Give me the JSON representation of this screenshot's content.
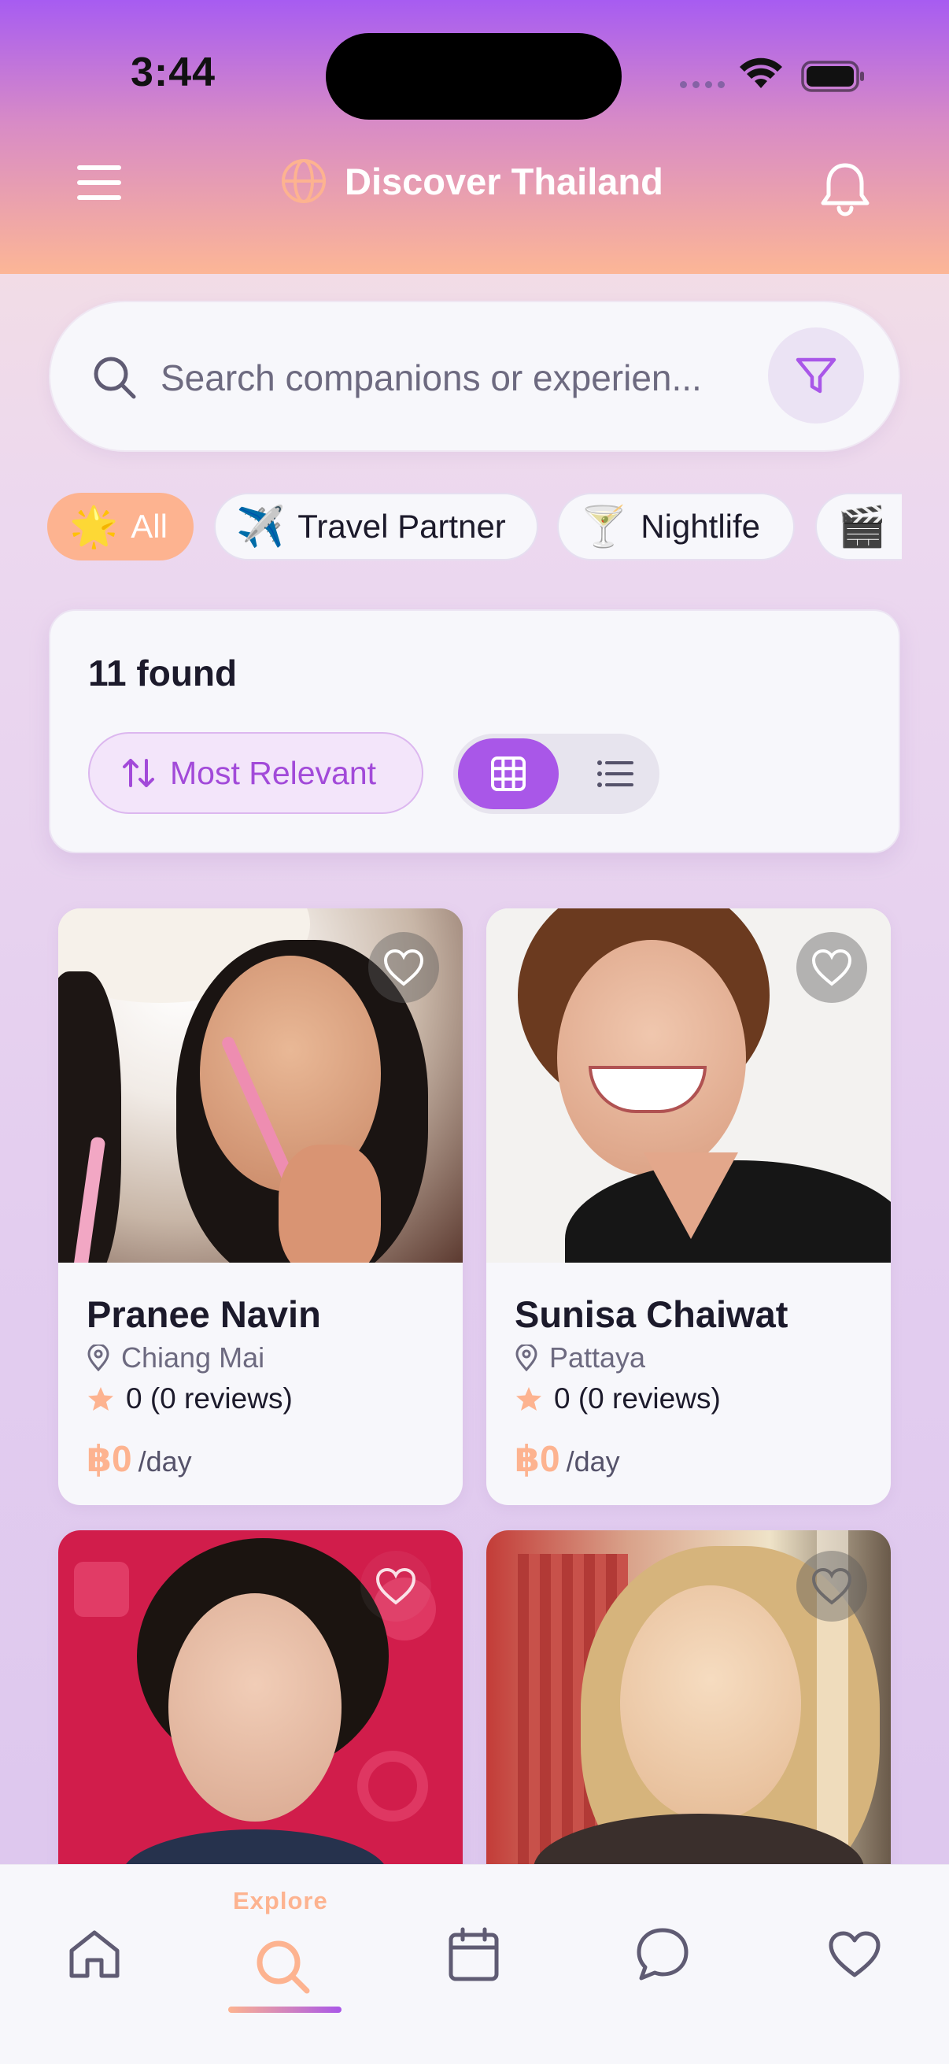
{
  "status_bar": {
    "time": "3:44"
  },
  "header": {
    "title": "Discover Thailand",
    "icons": [
      "menu-icon",
      "globe-icon",
      "bell-icon"
    ]
  },
  "search": {
    "placeholder": "Search companions or experien...",
    "filter_icon": "filter-icon"
  },
  "categories": [
    {
      "emoji": "🌟",
      "label": "All",
      "active": true
    },
    {
      "emoji": "✈️",
      "label": "Travel Partner",
      "active": false
    },
    {
      "emoji": "🍸",
      "label": "Nightlife",
      "active": false
    },
    {
      "emoji": "🎬",
      "label": "",
      "active": false
    }
  ],
  "results": {
    "count_text": "11 found",
    "sort_label": "Most Relevant",
    "view_mode": "grid"
  },
  "companions": [
    {
      "name": "Pranee Navin",
      "location": "Chiang Mai",
      "rating": "0 (0 reviews)",
      "price": "฿0",
      "unit": "/day"
    },
    {
      "name": "Sunisa Chaiwat",
      "location": "Pattaya",
      "rating": "0 (0 reviews)",
      "price": "฿0",
      "unit": "/day"
    },
    {
      "name": "",
      "location": "",
      "rating": "",
      "price": "",
      "unit": ""
    },
    {
      "name": "",
      "location": "",
      "rating": "",
      "price": "",
      "unit": ""
    }
  ],
  "bottom_nav": {
    "active_label": "Explore",
    "items": [
      "home-icon",
      "search-icon",
      "calendar-icon",
      "chat-icon",
      "heart-icon"
    ]
  },
  "colors": {
    "accent_peach": "#fdb390",
    "accent_purple": "#a957e8",
    "header_top": "#a75cf1"
  }
}
